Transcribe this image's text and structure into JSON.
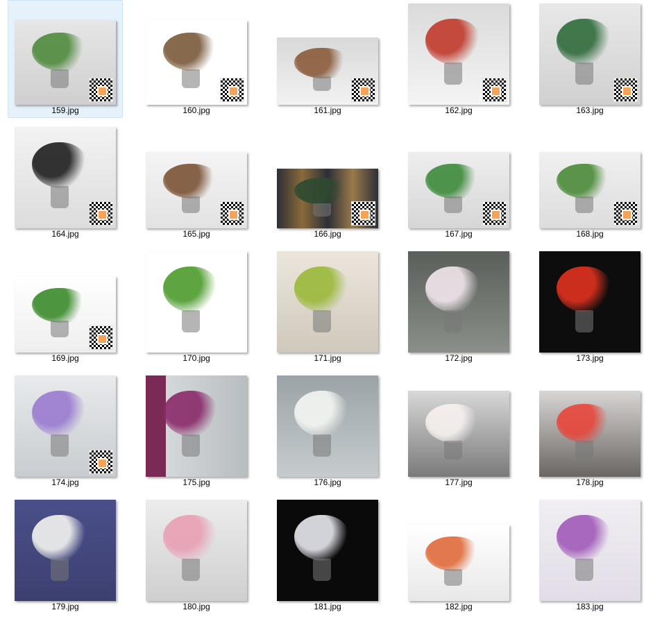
{
  "files": [
    {
      "name": "159.jpg",
      "selected": true,
      "thumb": {
        "w": 146,
        "h": 122,
        "bg": "linear-gradient(#e6e6e6,#cfcfcf)",
        "accent": "#4e8a3c"
      },
      "qr": true
    },
    {
      "name": "160.jpg",
      "thumb": {
        "w": 146,
        "h": 122,
        "bg": "#ffffff",
        "accent": "#7a5a3a"
      },
      "qr": true
    },
    {
      "name": "161.jpg",
      "thumb": {
        "w": 146,
        "h": 97,
        "bg": "linear-gradient(#d8d8d8,#f2f2f2)",
        "accent": "#8a5a3a"
      },
      "qr": true
    },
    {
      "name": "162.jpg",
      "thumb": {
        "w": 146,
        "h": 146,
        "bg": "linear-gradient(#dadada,#f4f4f4)",
        "accent": "#c0392b"
      },
      "qr": true
    },
    {
      "name": "163.jpg",
      "thumb": {
        "w": 146,
        "h": 146,
        "bg": "linear-gradient(#e8e8e8,#d0d0d0)",
        "accent": "#2e6b3a"
      },
      "qr": true
    },
    {
      "name": "164.jpg",
      "thumb": {
        "w": 146,
        "h": 146,
        "bg": "linear-gradient(#f2f2f2,#dcdcdc)",
        "accent": "#1e1e1e"
      },
      "qr": true
    },
    {
      "name": "165.jpg",
      "thumb": {
        "w": 146,
        "h": 110,
        "bg": "linear-gradient(#f4f4f4,#e2e2e2)",
        "accent": "#7a5236"
      },
      "qr": true
    },
    {
      "name": "166.jpg",
      "thumb": {
        "w": 146,
        "h": 86,
        "bg": "linear-gradient(90deg,#2c2f38,#8a6a3a,#2c2f38,#9a7a4a,#2c2f38)",
        "accent": "#2e4a30"
      },
      "qr": true
    },
    {
      "name": "167.jpg",
      "thumb": {
        "w": 146,
        "h": 110,
        "bg": "linear-gradient(#eeeeee,#d6d6d6)",
        "accent": "#3d8a3a"
      },
      "qr": true
    },
    {
      "name": "168.jpg",
      "thumb": {
        "w": 146,
        "h": 110,
        "bg": "linear-gradient(#f0f0f0,#dcdcdc)",
        "accent": "#4a8a38"
      },
      "qr": true
    },
    {
      "name": "169.jpg",
      "thumb": {
        "w": 146,
        "h": 110,
        "bg": "linear-gradient(#ffffff,#eeeeee)",
        "accent": "#3a8a2a"
      },
      "qr": true
    },
    {
      "name": "170.jpg",
      "thumb": {
        "w": 146,
        "h": 146,
        "bg": "#ffffff",
        "accent": "#4c9a2c"
      },
      "qr": false
    },
    {
      "name": "171.jpg",
      "thumb": {
        "w": 146,
        "h": 146,
        "bg": "linear-gradient(#ebe6dc,#cfc8bb)",
        "accent": "#9ab83a"
      },
      "qr": false
    },
    {
      "name": "172.jpg",
      "thumb": {
        "w": 146,
        "h": 146,
        "bg": "linear-gradient(#5a5f5a,#8a8f8a)",
        "accent": "#f2e6ec"
      },
      "qr": false
    },
    {
      "name": "173.jpg",
      "thumb": {
        "w": 146,
        "h": 146,
        "bg": "#0d0d0d",
        "accent": "#e0321e"
      },
      "qr": false
    },
    {
      "name": "174.jpg",
      "thumb": {
        "w": 146,
        "h": 146,
        "bg": "linear-gradient(#e8eaec,#c8cccf)",
        "accent": "#9a7ad0"
      },
      "qr": true
    },
    {
      "name": "175.jpg",
      "thumb": {
        "w": 146,
        "h": 146,
        "bg": "linear-gradient(90deg,#7a2a55 0,#7a2a55 20%,#d4d8da 20%,#b8bdc0)",
        "accent": "#8a2a6a"
      },
      "qr": false
    },
    {
      "name": "176.jpg",
      "thumb": {
        "w": 146,
        "h": 146,
        "bg": "linear-gradient(#9aa3a6,#c6ccce)",
        "accent": "#f4f6f2"
      },
      "qr": false
    },
    {
      "name": "177.jpg",
      "thumb": {
        "w": 146,
        "h": 124,
        "bg": "linear-gradient(#d8d8d8,#7a7a7a)",
        "accent": "#f7f2f0"
      },
      "qr": false
    },
    {
      "name": "178.jpg",
      "thumb": {
        "w": 146,
        "h": 124,
        "bg": "linear-gradient(#d8d6d4,#6a6664)",
        "accent": "#e8453a"
      },
      "qr": false
    },
    {
      "name": "179.jpg",
      "thumb": {
        "w": 146,
        "h": 146,
        "bg": "linear-gradient(#4a4f8a,#3c4070)",
        "accent": "#f4f4f0"
      },
      "qr": false
    },
    {
      "name": "180.jpg",
      "thumb": {
        "w": 146,
        "h": 146,
        "bg": "linear-gradient(#ececec,#cfcfcf)",
        "accent": "#e8a0b4"
      },
      "qr": false
    },
    {
      "name": "181.jpg",
      "thumb": {
        "w": 146,
        "h": 146,
        "bg": "#0a0a0a",
        "accent": "#e8e8f0"
      },
      "qr": false
    },
    {
      "name": "182.jpg",
      "thumb": {
        "w": 146,
        "h": 110,
        "bg": "linear-gradient(#ffffff,#e8e8e8)",
        "accent": "#e06a3a"
      },
      "qr": false
    },
    {
      "name": "183.jpg",
      "thumb": {
        "w": 146,
        "h": 146,
        "bg": "linear-gradient(#f0eef2,#e2dce6)",
        "accent": "#a05ab8"
      },
      "qr": false
    }
  ]
}
